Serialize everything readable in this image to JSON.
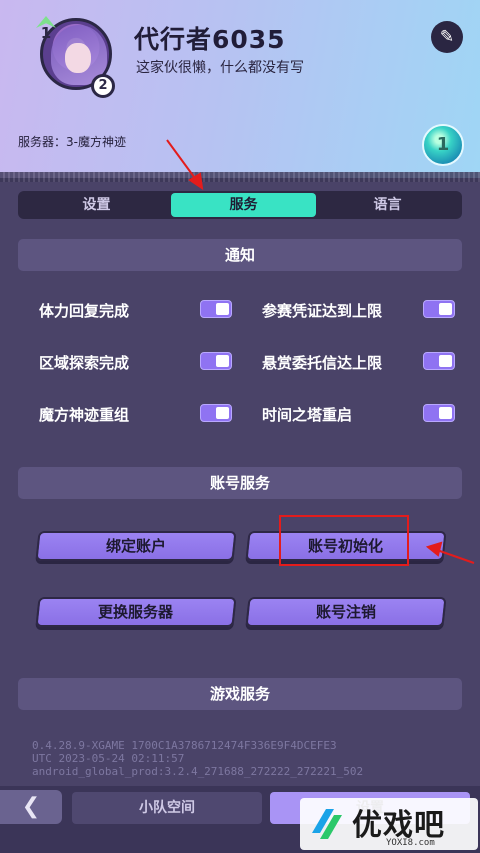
{
  "profile": {
    "username": "代行者6035",
    "signature": "这家伙很懒，什么都没有写",
    "level": "1",
    "rank": "2",
    "server_label": "服务器：3-魔方神迹",
    "gem_value": "1"
  },
  "tabs": [
    {
      "label": "设置"
    },
    {
      "label": "服务"
    },
    {
      "label": "语言"
    }
  ],
  "notify": {
    "title": "通知",
    "options": [
      {
        "label": "体力回复完成",
        "on": true
      },
      {
        "label": "参赛凭证达到上限",
        "on": true
      },
      {
        "label": "区域探索完成",
        "on": true
      },
      {
        "label": "悬赏委托信达上限",
        "on": true
      },
      {
        "label": "魔方神迹重组",
        "on": true
      },
      {
        "label": "时间之塔重启",
        "on": true
      }
    ]
  },
  "account": {
    "title": "账号服务",
    "buttons": [
      {
        "label": "绑定账户"
      },
      {
        "label": "账号初始化"
      },
      {
        "label": "更换服务器"
      },
      {
        "label": "账号注销"
      }
    ]
  },
  "game_service": {
    "title": "游戏服务"
  },
  "version": {
    "line1": "0.4.28.9-XGAME 1700C1A3786712474F336E9F4DCEFE3",
    "line2": "UTC 2023-05-24 02:11:57",
    "line3": "android_global_prod:3.2.4_271688_272222_272221_502"
  },
  "bottom": {
    "back_label": "❮",
    "squad_label": "小队空间",
    "settings_label": "设置"
  },
  "watermark": {
    "text": "优戏吧",
    "sub": "YOXI8.com"
  },
  "colors": {
    "accent_tab": "#39e3c4",
    "toggle_on": "#8f73f2",
    "button": "#9b83f2",
    "annotation_red": "#e31c1c"
  }
}
